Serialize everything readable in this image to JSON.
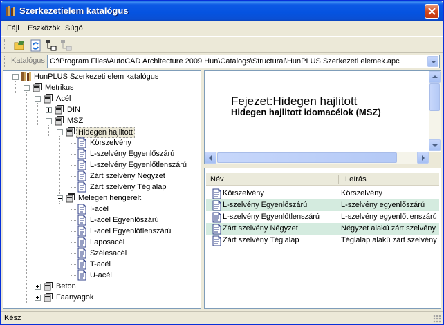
{
  "window": {
    "title": "Szerkezetielem katalógus"
  },
  "menu": [
    "Fájl",
    "Eszközök",
    "Súgó"
  ],
  "toolbar": {
    "buttons": [
      "open-catalog-icon",
      "refresh-icon",
      "tree-add-icon",
      "tree-link-icon"
    ]
  },
  "catalog_bar": {
    "label": "Katalógus",
    "path": "C:\\Program Files\\AutoCAD Architecture 2009 Hun\\Catalogs\\Structural\\HunPLUS Szerkezeti elemek.apc"
  },
  "tree": {
    "root": "HunPLUS Szerkezeti elem katalógus",
    "metric": "Metrikus",
    "steel": "Acél",
    "din": "DIN",
    "msz": "MSZ",
    "cold": "Hidegen hajlitott",
    "cold_items": [
      "Körszelvény",
      "L-szelvény Egyenlőszárú",
      "L-szelvény Egyenlőtlenszárú",
      "Zárt szelvény Négyzet",
      "Zárt szelvény Téglalap"
    ],
    "hot": "Melegen hengerelt",
    "hot_items": [
      "I-acél",
      "L-acél Egyenlőszárú",
      "L-acél Egyenlőtlenszárú",
      "Laposacél",
      "Szélesacél",
      "T-acél",
      "U-acél"
    ],
    "concrete": "Beton",
    "wood": "Faanyagok"
  },
  "preview": {
    "chapter": "Fejezet:Hidegen hajlitott",
    "subtitle": "Hidegen hajlitott idomacélok (MSZ)"
  },
  "list": {
    "columns": [
      "Név",
      "Leírás"
    ],
    "rows": [
      {
        "name": "Körszelvény",
        "desc": "Körszelvény"
      },
      {
        "name": "L-szelvény Egyenlőszárú",
        "desc": "L-szelvény egyenlőszárú"
      },
      {
        "name": "L-szelvény Egyenlőtlenszárú",
        "desc": "L-szelvény egyenlőtlenszárú"
      },
      {
        "name": "Zárt szelvény Négyzet",
        "desc": "Négyzet alakú zárt szelvény"
      },
      {
        "name": "Zárt szelvény Téglalap",
        "desc": "Téglalap alakú zárt szelvény"
      }
    ],
    "highlight_color": "#d4ebdf"
  },
  "status": "Kész",
  "colors": {
    "titlebar": "#0553e0",
    "selection": "#ece9d8"
  }
}
